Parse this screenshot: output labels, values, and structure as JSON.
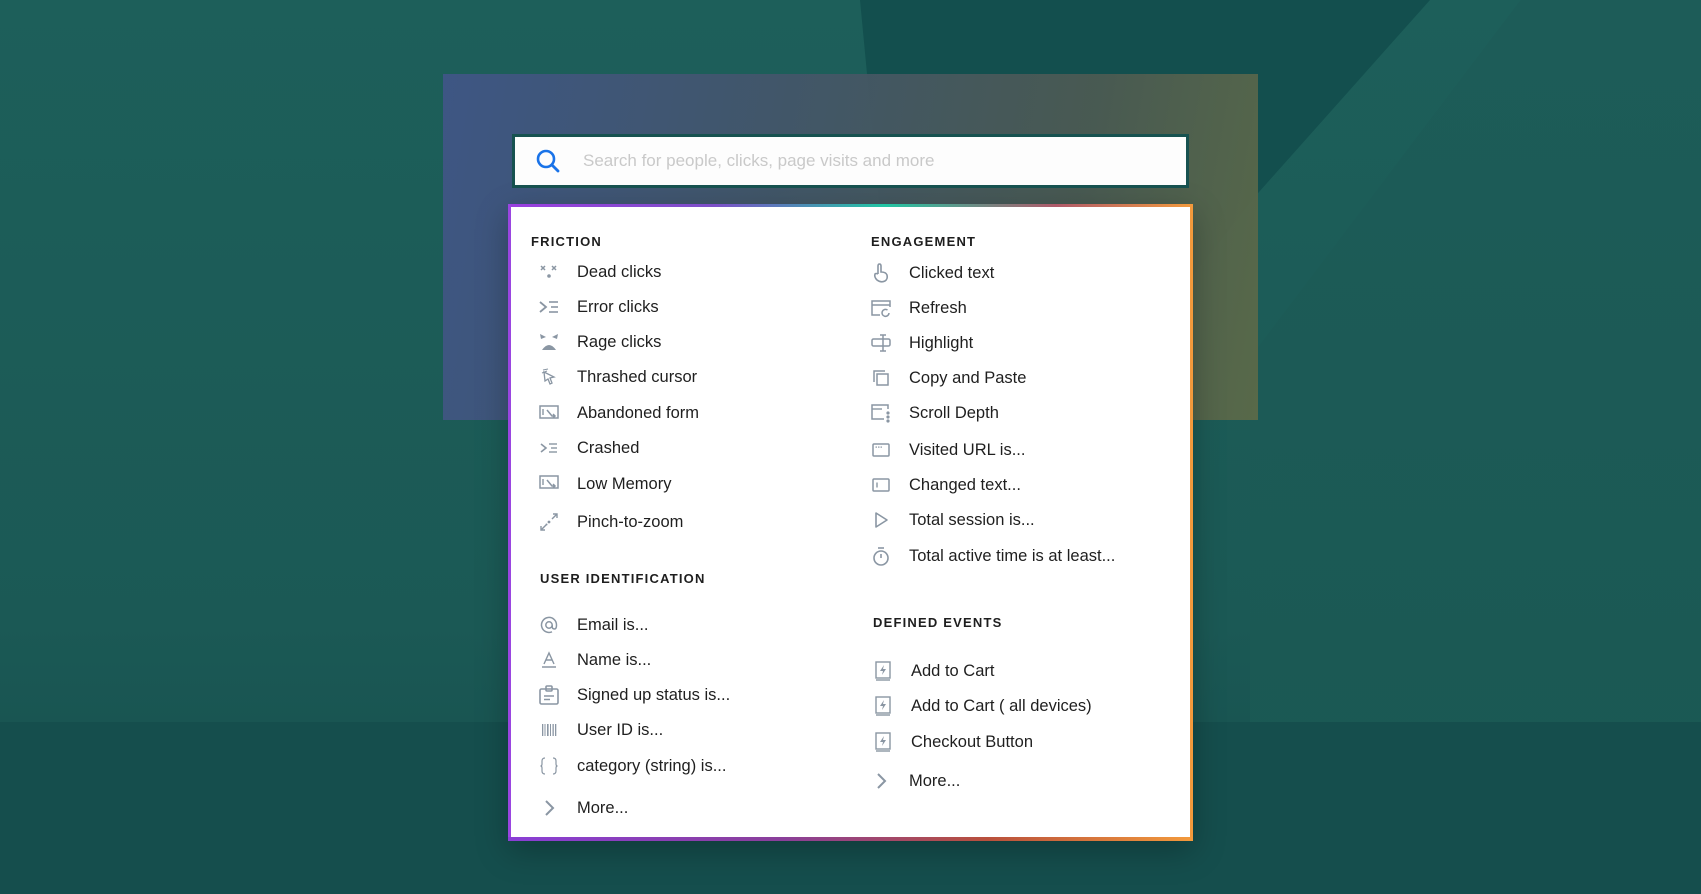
{
  "search": {
    "placeholder": "Search for people, clicks, page visits and more",
    "value": ""
  },
  "friction": {
    "title": "FRICTION",
    "items": [
      {
        "label": "Dead clicks",
        "icon": "dead-clicks-icon"
      },
      {
        "label": "Error clicks",
        "icon": "error-clicks-icon"
      },
      {
        "label": "Rage clicks",
        "icon": "rage-clicks-icon"
      },
      {
        "label": "Thrashed cursor",
        "icon": "thrashed-cursor-icon"
      },
      {
        "label": "Abandoned form",
        "icon": "abandoned-form-icon"
      },
      {
        "label": "Crashed",
        "icon": "crashed-icon"
      },
      {
        "label": "Low Memory",
        "icon": "low-memory-icon"
      },
      {
        "label": "Pinch-to-zoom",
        "icon": "pinch-zoom-icon"
      }
    ]
  },
  "user_identification": {
    "title": "USER IDENTIFICATION",
    "items": [
      {
        "label": "Email is...",
        "icon": "at-sign-icon"
      },
      {
        "label": "Name is...",
        "icon": "name-letter-icon"
      },
      {
        "label": "Signed up status is...",
        "icon": "clipboard-icon"
      },
      {
        "label": "User ID is...",
        "icon": "barcode-icon"
      },
      {
        "label": "category (string) is...",
        "icon": "curly-braces-icon"
      },
      {
        "label": "More...",
        "icon": "chevron-right-icon"
      }
    ]
  },
  "engagement": {
    "title": "ENGAGEMENT",
    "items": [
      {
        "label": "Clicked text",
        "icon": "pointer-hand-icon"
      },
      {
        "label": "Refresh",
        "icon": "refresh-window-icon"
      },
      {
        "label": "Highlight",
        "icon": "text-cursor-icon"
      },
      {
        "label": "Copy and Paste",
        "icon": "copy-icon"
      },
      {
        "label": "Scroll Depth",
        "icon": "scroll-depth-icon"
      },
      {
        "label": "Visited URL is...",
        "icon": "browser-window-icon"
      },
      {
        "label": "Changed text...",
        "icon": "text-field-icon"
      },
      {
        "label": "Total session is...",
        "icon": "play-icon"
      },
      {
        "label": "Total active time is at least...",
        "icon": "stopwatch-icon"
      }
    ]
  },
  "defined_events": {
    "title": "DEFINED EVENTS",
    "items": [
      {
        "label": "Add to Cart",
        "icon": "event-bolt-icon"
      },
      {
        "label": "Add to Cart ( all devices)",
        "icon": "event-bolt-icon"
      },
      {
        "label": "Checkout Button",
        "icon": "event-bolt-icon"
      },
      {
        "label": "More...",
        "icon": "chevron-right-icon"
      }
    ]
  },
  "colors": {
    "accent_blue": "#1a73e8",
    "icon_gray": "#8a96a3",
    "text": "#1f1f1f"
  }
}
